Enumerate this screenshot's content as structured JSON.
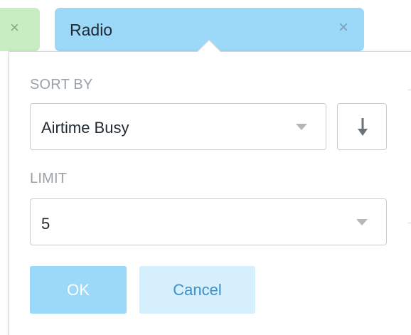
{
  "filters": {
    "previous_pill": {
      "close_icon": "close-icon",
      "close_glyph": "×"
    },
    "active_pill": {
      "label": "Radio",
      "close_icon": "close-icon",
      "close_glyph": "×"
    }
  },
  "popover": {
    "sort_by": {
      "label": "SORT BY",
      "selected": "Airtime Busy",
      "dropdown_icon": "chevron-down-icon",
      "direction_icon": "arrow-down-icon"
    },
    "limit": {
      "label": "LIMIT",
      "selected": "5",
      "dropdown_icon": "chevron-down-icon"
    },
    "actions": {
      "ok_label": "OK",
      "cancel_label": "Cancel"
    }
  },
  "colors": {
    "active_pill": "#9cd8f8",
    "previous_pill": "#c9edc3",
    "ok_button": "#9cd8f8",
    "cancel_button": "#d6effd",
    "cancel_text": "#3f8fc6"
  }
}
